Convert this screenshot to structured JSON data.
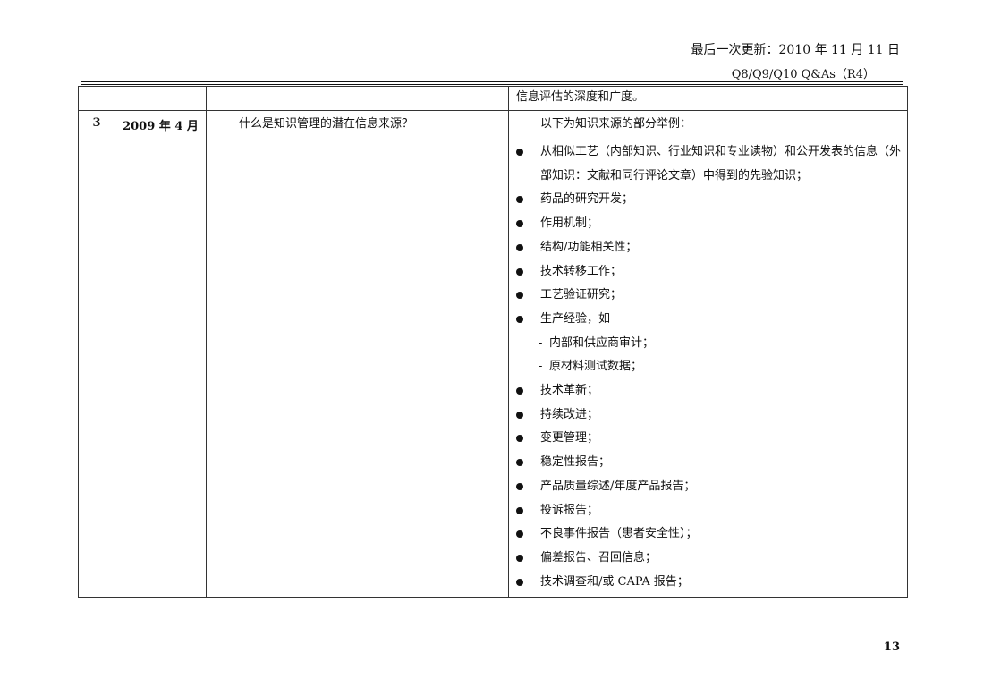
{
  "header": {
    "updated": "最后一次更新：2010 年 11 月 11 日",
    "doc_title": "Q8/Q9/Q10 Q&As（R4）"
  },
  "table": {
    "continuation_answer": "信息评估的深度和广度。",
    "row": {
      "number": "3",
      "date": "2009 年 4 月",
      "question": "什么是知识管理的潜在信息来源？",
      "answer_intro": "以下为知识来源的部分举例：",
      "items": [
        "从相似工艺（内部知识、行业知识和专业读物）和公开发表的信息（外部知识：文献和同行评论文章）中得到的先验知识；",
        "药品的研究开发；",
        "作用机制；",
        "结构/功能相关性；",
        "技术转移工作；",
        "工艺验证研究；",
        "生产经验，如",
        "技术革新；",
        "持续改进；",
        "变更管理；",
        "稳定性报告；",
        "产品质量综述/年度产品报告；",
        "投诉报告；",
        "不良事件报告（患者安全性）；",
        "偏差报告、召回信息；",
        "技术调查和/或 CAPA 报告；"
      ],
      "sub_items": [
        "内部和供应商审计；",
        "原材料测试数据；"
      ]
    }
  },
  "footer": {
    "page_number": "13"
  }
}
